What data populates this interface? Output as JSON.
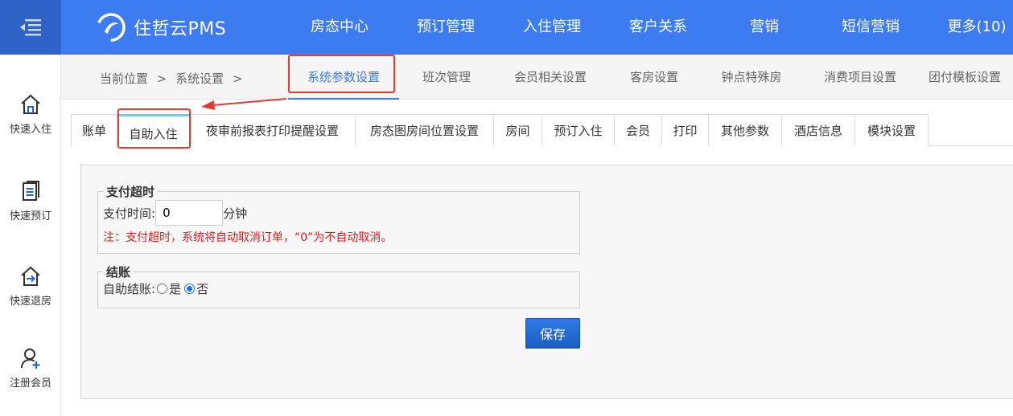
{
  "app": {
    "name": "住哲云PMS"
  },
  "nav": {
    "items": [
      {
        "label": "房态中心"
      },
      {
        "label": "预订管理"
      },
      {
        "label": "入住管理"
      },
      {
        "label": "客户关系"
      },
      {
        "label": "营销"
      },
      {
        "label": "短信营销"
      },
      {
        "label": "更多(10)"
      }
    ]
  },
  "sidebar": {
    "items": [
      {
        "label": "快速入住",
        "icon": "home-icon"
      },
      {
        "label": "快速预订",
        "icon": "document-icon"
      },
      {
        "label": "快速退房",
        "icon": "checkout-icon"
      },
      {
        "label": "注册会员",
        "icon": "add-user-icon"
      }
    ]
  },
  "breadcrumb": {
    "current": "当前位置",
    "sep1": ">",
    "section": "系统设置",
    "sep2": ">"
  },
  "module_tabs": [
    {
      "label": "系统参数设置",
      "active": true
    },
    {
      "label": "班次管理"
    },
    {
      "label": "会员相关设置"
    },
    {
      "label": "客房设置"
    },
    {
      "label": "钟点特殊房"
    },
    {
      "label": "消费项目设置"
    },
    {
      "label": "团付模板设置"
    }
  ],
  "sub_tabs": [
    {
      "label": "账单"
    },
    {
      "label": "自助入住",
      "active": true
    },
    {
      "label": "夜审前报表打印提醒设置"
    },
    {
      "label": "房态图房间位置设置"
    },
    {
      "label": "房间"
    },
    {
      "label": "预订入住"
    },
    {
      "label": "会员"
    },
    {
      "label": "打印"
    },
    {
      "label": "其他参数"
    },
    {
      "label": "酒店信息"
    },
    {
      "label": "模块设置"
    }
  ],
  "payment_timeout": {
    "legend": "支付超时",
    "label": "支付时间:",
    "value": "0",
    "unit": "分钟",
    "note": "注：支付超时，系统将自动取消订单，“0”为不自动取消。"
  },
  "checkout": {
    "legend": "结账",
    "label": "自助结账:",
    "options": [
      {
        "label": "是",
        "checked": false
      },
      {
        "label": "否",
        "checked": true
      }
    ]
  },
  "save_button": {
    "label": "保存"
  },
  "colors": {
    "primary": "#3d7bf0",
    "highlight": "#e53a2f",
    "note": "#e01a1a"
  }
}
